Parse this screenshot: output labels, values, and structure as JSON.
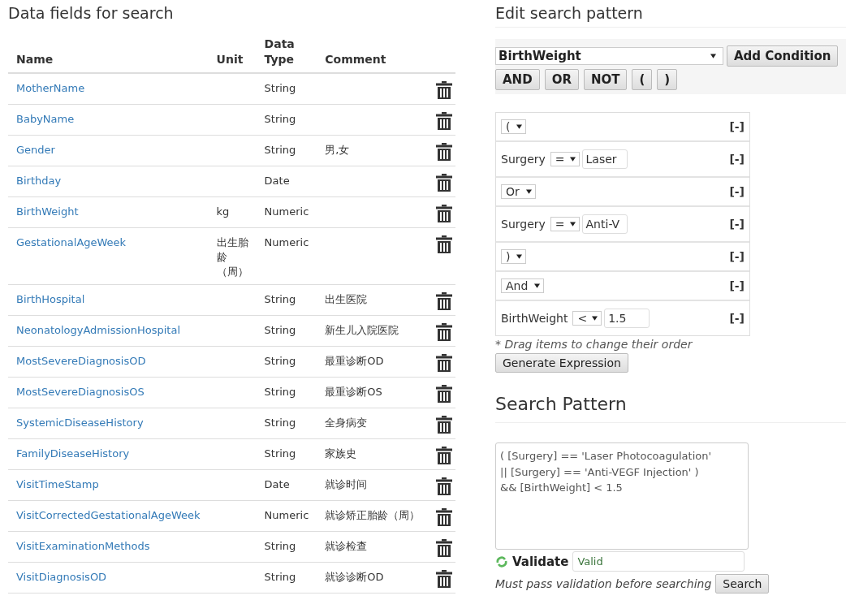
{
  "fields_panel": {
    "title": "Data fields for search",
    "columns": [
      "Name",
      "Unit",
      "Data Type",
      "Comment"
    ],
    "rows": [
      {
        "name": "MotherName",
        "unit": "",
        "type": "String",
        "comment": ""
      },
      {
        "name": "BabyName",
        "unit": "",
        "type": "String",
        "comment": ""
      },
      {
        "name": "Gender",
        "unit": "",
        "type": "String",
        "comment": "男,女"
      },
      {
        "name": "Birthday",
        "unit": "",
        "type": "Date",
        "comment": ""
      },
      {
        "name": "BirthWeight",
        "unit": "kg",
        "type": "Numeric",
        "comment": ""
      },
      {
        "name": "GestationalAgeWeek",
        "unit": "出生胎龄（周）",
        "type": "Numeric",
        "comment": ""
      },
      {
        "name": "BirthHospital",
        "unit": "",
        "type": "String",
        "comment": "出生医院"
      },
      {
        "name": "NeonatologyAdmissionHospital",
        "unit": "",
        "type": "String",
        "comment": "新生儿入院医院"
      },
      {
        "name": "MostSevereDiagnosisOD",
        "unit": "",
        "type": "String",
        "comment": "最重诊断OD"
      },
      {
        "name": "MostSevereDiagnosisOS",
        "unit": "",
        "type": "String",
        "comment": "最重诊断OS"
      },
      {
        "name": "SystemicDiseaseHistory",
        "unit": "",
        "type": "String",
        "comment": "全身病变"
      },
      {
        "name": "FamilyDiseaseHistory",
        "unit": "",
        "type": "String",
        "comment": "家族史"
      },
      {
        "name": "VisitTimeStamp",
        "unit": "",
        "type": "Date",
        "comment": "就诊时间"
      },
      {
        "name": "VisitCorrectedGestationalAgeWeek",
        "unit": "",
        "type": "Numeric",
        "comment": "就诊矫正胎龄（周）"
      },
      {
        "name": "VisitExaminationMethods",
        "unit": "",
        "type": "String",
        "comment": "就诊检查"
      },
      {
        "name": "VisitDiagnosisOD",
        "unit": "",
        "type": "String",
        "comment": "就诊诊断OD"
      }
    ]
  },
  "edit_panel": {
    "title": "Edit search pattern",
    "field_select": "BirthWeight",
    "add_button": "Add Condition",
    "operator_buttons": [
      "AND",
      "OR",
      "NOT",
      "(",
      ")"
    ],
    "conditions": [
      {
        "kind": "select",
        "value": "(",
        "remove": "[-]"
      },
      {
        "kind": "condition",
        "field": "Surgery",
        "operator": "=",
        "value": "Laser",
        "remove": "[-]"
      },
      {
        "kind": "select",
        "value": "Or",
        "remove": "[-]"
      },
      {
        "kind": "condition",
        "field": "Surgery",
        "operator": "=",
        "value": "Anti-V",
        "remove": "[-]"
      },
      {
        "kind": "select",
        "value": ")",
        "remove": "[-]"
      },
      {
        "kind": "select",
        "value": "And",
        "remove": "[-]"
      },
      {
        "kind": "condition",
        "field": "BirthWeight",
        "operator": "<",
        "value": "1.5",
        "remove": "[-]"
      }
    ],
    "hint": "* Drag items to change their order",
    "generate_button": "Generate Expression"
  },
  "pattern_panel": {
    "title": "Search Pattern",
    "expression": "( [Surgery] == 'Laser Photocoagulation'\n|| [Surgery] == 'Anti-VEGF Injection' )\n&& [BirthWeight] < 1.5",
    "validate_label": "Validate",
    "validation_result": "Valid",
    "note": "Must pass validation before searching",
    "search_button": "Search"
  }
}
